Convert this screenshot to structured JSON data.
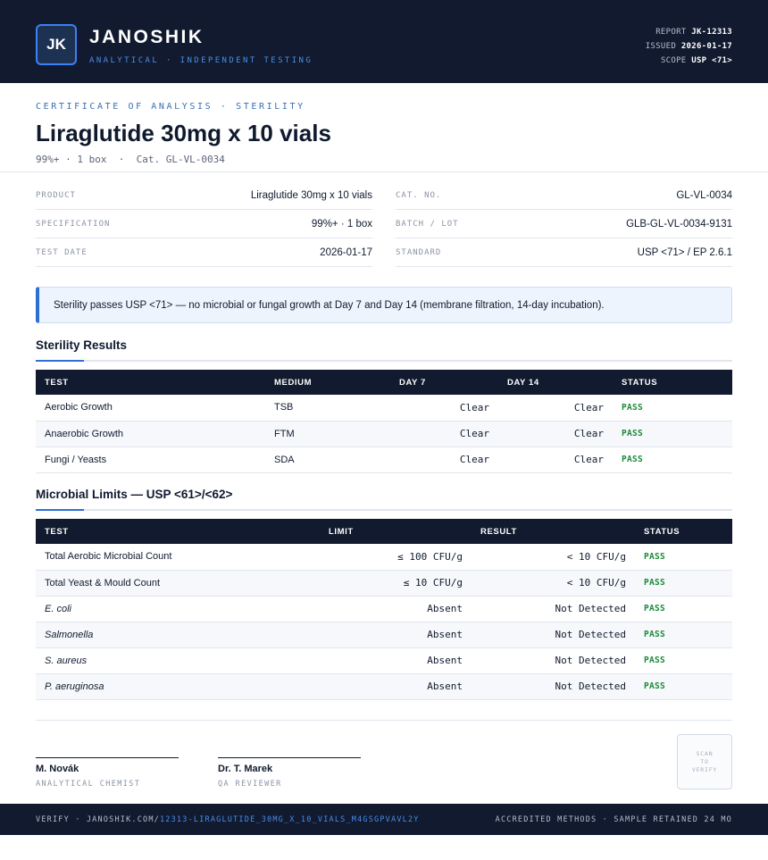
{
  "header": {
    "logo_initials": "JK",
    "brand_name": "JANOSHIK",
    "tagline": "ANALYTICAL · INDEPENDENT TESTING",
    "report_label": "REPORT",
    "report_value": "JK-12313",
    "issued_label": "ISSUED",
    "issued_value": "2026-01-17",
    "scope_label": "SCOPE",
    "scope_value": "USP <71>"
  },
  "title_block": {
    "doc_type": "CERTIFICATE OF ANALYSIS · STERILITY",
    "title": "Liraglutide 30mg x 10 vials",
    "subtitle": "99%+ · 1 box  ·  Cat. GL-VL-0034"
  },
  "info": {
    "left": [
      {
        "label": "PRODUCT",
        "value": "Liraglutide 30mg x 10 vials"
      },
      {
        "label": "SPECIFICATION",
        "value": "99%+ · 1 box"
      },
      {
        "label": "TEST DATE",
        "value": "2026-01-17"
      }
    ],
    "right": [
      {
        "label": "CAT. NO.",
        "value": "GL-VL-0034"
      },
      {
        "label": "BATCH / LOT",
        "value": "GLB-GL-VL-0034-9131"
      },
      {
        "label": "STANDARD",
        "value": "USP <71> / EP 2.6.1"
      }
    ]
  },
  "callout": "Sterility passes USP <71> — no microbial or fungal growth at Day 7 and Day 14 (membrane filtration, 14-day incubation).",
  "sterility": {
    "title": "Sterility Results",
    "headers": [
      "TEST",
      "MEDIUM",
      "DAY 7",
      "DAY 14",
      "STATUS"
    ],
    "rows": [
      [
        "Aerobic Growth",
        "TSB",
        "Clear",
        "Clear",
        "PASS"
      ],
      [
        "Anaerobic Growth",
        "FTM",
        "Clear",
        "Clear",
        "PASS"
      ],
      [
        "Fungi / Yeasts",
        "SDA",
        "Clear",
        "Clear",
        "PASS"
      ]
    ]
  },
  "microbial": {
    "title": "Microbial Limits — USP <61>/<62>",
    "headers": [
      "TEST",
      "LIMIT",
      "RESULT",
      "STATUS"
    ],
    "rows": [
      [
        "Total Aerobic Microbial Count",
        "≤ 100 CFU/g",
        "< 10 CFU/g",
        "PASS"
      ],
      [
        "Total Yeast & Mould Count",
        "≤ 10 CFU/g",
        "< 10 CFU/g",
        "PASS"
      ],
      [
        "E. coli",
        "Absent",
        "Not Detected",
        "PASS"
      ],
      [
        "Salmonella",
        "Absent",
        "Not Detected",
        "PASS"
      ],
      [
        "S. aureus",
        "Absent",
        "Not Detected",
        "PASS"
      ],
      [
        "P. aeruginosa",
        "Absent",
        "Not Detected",
        "PASS"
      ]
    ]
  },
  "signatures": [
    {
      "name": "M. Novák",
      "role": "ANALYTICAL CHEMIST"
    },
    {
      "name": "Dr. T. Marek",
      "role": "QA REVIEWER"
    }
  ],
  "qr": {
    "line1": "SCAN",
    "line2": "TO",
    "line3": "VERIFY"
  },
  "footer": {
    "verify_prefix": "VERIFY · JANOSHIK.COM/",
    "verify_link": "12313-LIRAGLUTIDE_30MG_X_10_VIALS_M4GSGPVAVL2Y",
    "right_text": "ACCREDITED METHODS · SAMPLE RETAINED 24 MO"
  },
  "colors": {
    "navy": "#111a2e",
    "accent": "#2e6fd4",
    "pass": "#1b8a3a"
  }
}
